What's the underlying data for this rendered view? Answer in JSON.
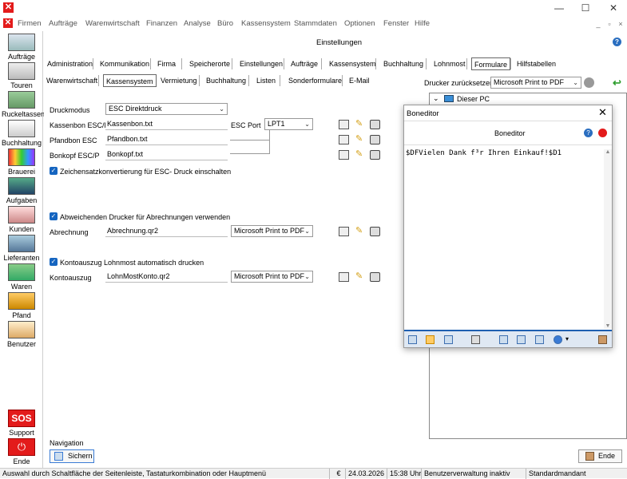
{
  "window": {
    "minimize": "—",
    "maximize": "☐",
    "close": "✕"
  },
  "menu": {
    "items": [
      "Firmen",
      "Aufträge",
      "Warenwirtschaft",
      "Finanzen",
      "Analyse",
      "Büro",
      "Kassensystem",
      "Stammdaten",
      "Optionen",
      "Fenster",
      "Hilfe"
    ],
    "mdi": [
      "_",
      "▫",
      "×"
    ]
  },
  "sidebar": {
    "items": [
      "Aufträge",
      "Touren",
      "Ruckeltassen",
      "Buchhaltung",
      "Brauerei",
      "Aufgaben",
      "Kunden",
      "Lieferanten",
      "Waren",
      "Pfand",
      "Benutzer"
    ],
    "support": "Support",
    "sos": "SOS",
    "ende": "Ende"
  },
  "page": {
    "title": "Einstellungen"
  },
  "tabs_row1": [
    "Administration",
    "Kommunikation",
    "Firma",
    "Speicherorte",
    "Einstellungen",
    "Aufträge",
    "Kassensystem",
    "Buchhaltung",
    "Lohnmost",
    "Formulare",
    "Hilfstabellen"
  ],
  "tabs_row1_selected": "Formulare",
  "tabs_row2": [
    "Warenwirtschaft",
    "Kassensystem",
    "Vermietung",
    "Buchhaltung",
    "Listen",
    "Sonderformulare",
    "E-Mail"
  ],
  "tabs_row2_selected": "Kassensystem",
  "printer_reset": {
    "label": "Drucker zurücksetzen:",
    "value": "Microsoft Print to PDF"
  },
  "form": {
    "druckmodus": {
      "label": "Druckmodus",
      "value": "ESC Direktdruck"
    },
    "kassenbon": {
      "label": "Kassenbon ESC/P",
      "value": "Kassenbon.txt"
    },
    "escport": {
      "label": "ESC Port",
      "value": "LPT1"
    },
    "pfandbon": {
      "label": "Pfandbon ESC",
      "value": "Pfandbon.txt"
    },
    "bonkopf": {
      "label": "Bonkopf ESC/P",
      "value": "Bonkopf.txt"
    },
    "zeichensatz": "Zeichensatzkonvertierung für ESC- Druck einschalten",
    "abweichend": "Abweichenden Drucker für Abrechnungen verwenden",
    "abrechnung": {
      "label": "Abrechnung",
      "value": "Abrechnung.qr2",
      "printer": "Microsoft Print to PDF"
    },
    "kontoauszug_chk": "Kontoauszug Lohnmost automatisch drucken",
    "kontoauszug": {
      "label": "Kontoauszug",
      "value": "LohnMostKonto.qr2",
      "printer": "Microsoft Print to PDF"
    }
  },
  "tree": {
    "root": "Dieser PC"
  },
  "editor": {
    "title": "Boneditor",
    "header": "Boneditor",
    "text": "$DFVielen Dank f³r Ihren Einkauf!$D1"
  },
  "nav": {
    "label": "Navigation",
    "save": "Sichern",
    "end": "Ende"
  },
  "status": {
    "hint": "Auswahl durch Schaltfläche der Seitenleiste, Tastaturkombination oder Hauptmenü",
    "currency": "€",
    "date": "24.03.2026",
    "time": "15:38 Uhr",
    "user_mgmt": "Benutzerverwaltung inaktiv",
    "mandant": "Standardmandant"
  },
  "colors": {
    "brand_red": "#e31b1b",
    "accent_blue": "#1565c0",
    "green_arrow": "#2e9e2e"
  }
}
